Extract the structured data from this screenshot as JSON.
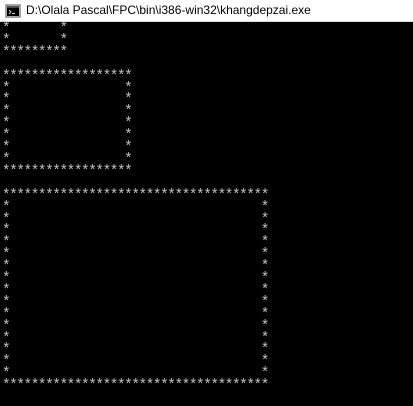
{
  "window": {
    "title": "D:\\Olala Pascal\\FPC\\bin\\i386-win32\\khangdepzai.exe",
    "icon": "console-app-icon"
  },
  "console": {
    "output": "*       *\n*       *\n*********\n\n******************\n*                *\n*                *\n*                *\n*                *\n*                *\n*                *\n*                *\n******************\n\n*************************************\n*                                   *\n*                                   *\n*                                   *\n*                                   *\n*                                   *\n*                                   *\n*                                   *\n*                                   *\n*                                   *\n*                                   *\n*                                   *\n*                                   *\n*                                   *\n*                                   *\n*                                   *\n*************************************"
  },
  "colors": {
    "console_background": "#000000",
    "console_text": "#c0c0c0",
    "titlebar_background": "#ffffff"
  }
}
